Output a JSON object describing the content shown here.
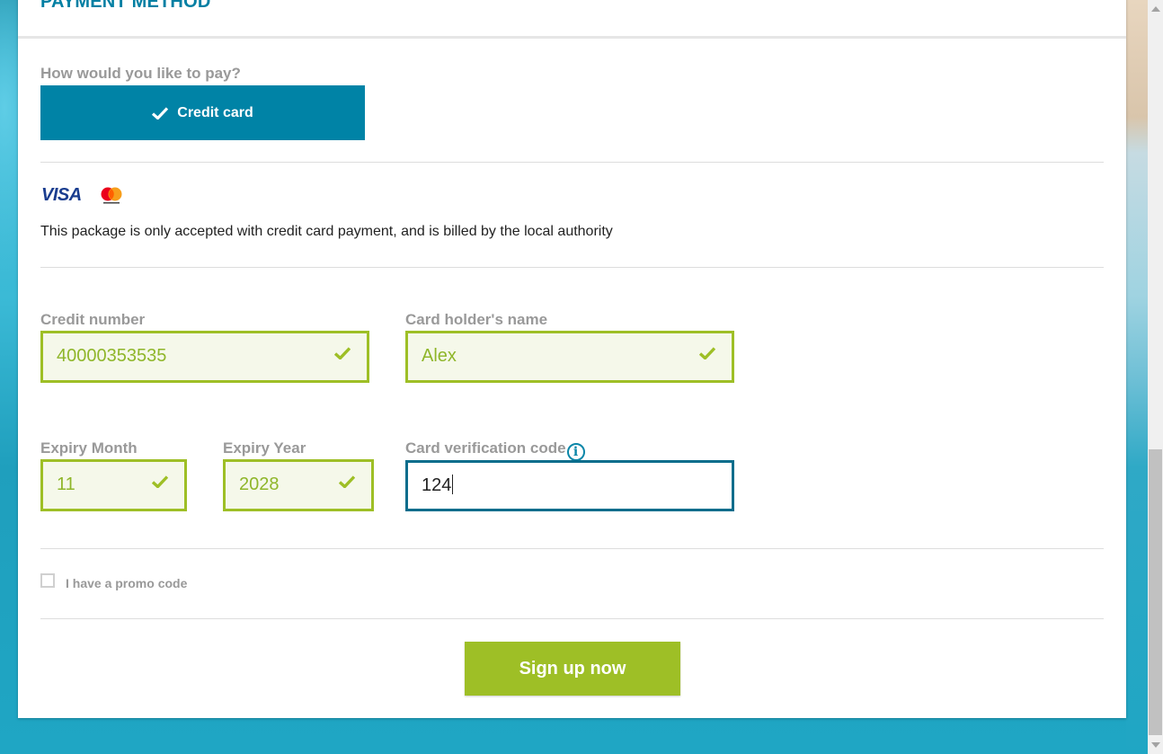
{
  "section": {
    "title": "PAYMENT METHOD"
  },
  "payment": {
    "question": "How would you like to pay?",
    "option_label": "Credit card",
    "brand_visa": "VISA",
    "notice": "This package is only accepted with credit card payment, and is billed by the local authority"
  },
  "form": {
    "card_number_label": "Credit number",
    "card_number_value": "40000353535",
    "holder_label": "Card holder's name",
    "holder_value": "Alex",
    "expiry_month_label": "Expiry Month",
    "expiry_month_value": "11",
    "expiry_year_label": "Expiry Year",
    "expiry_year_value": "2028",
    "cvc_label": "Card verification code",
    "cvc_value": "124",
    "info_glyph": "i"
  },
  "promo": {
    "label": "I have a promo code",
    "checked": false
  },
  "actions": {
    "signup_label": "Sign up now"
  },
  "colors": {
    "accent_blue": "#0083a6",
    "valid_green": "#9ebf26",
    "valid_fill": "#f5f8ea",
    "label_gray": "#999999"
  },
  "icons": {
    "selected": "checkmark-icon",
    "valid": "checkmark-icon",
    "info": "info-icon",
    "mastercard": "mastercard-logo"
  }
}
